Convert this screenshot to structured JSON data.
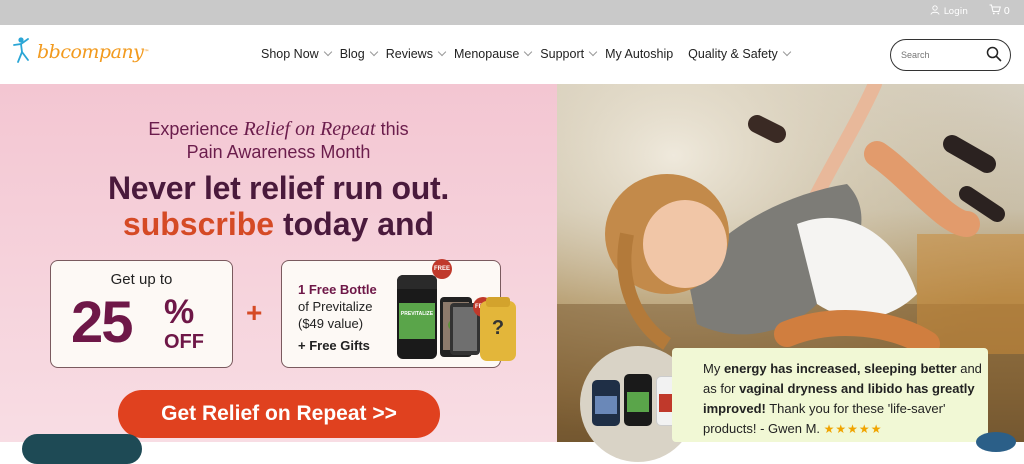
{
  "topbar": {
    "login_label": "Login",
    "cart_count": "0"
  },
  "header": {
    "logo_text": "bbcompany",
    "logo_tm": "™",
    "nav": [
      {
        "label": "Shop Now",
        "has_dropdown": true
      },
      {
        "label": "Blog",
        "has_dropdown": true
      },
      {
        "label": "Reviews",
        "has_dropdown": true
      },
      {
        "label": "Menopause",
        "has_dropdown": true
      },
      {
        "label": "Support",
        "has_dropdown": true
      },
      {
        "label": "My Autoship",
        "has_dropdown": false
      },
      {
        "label": "Quality & Safety",
        "has_dropdown": true
      }
    ],
    "search_placeholder": "Search"
  },
  "hero": {
    "line1_pre": "Experience ",
    "line1_em": "Relief on Repeat",
    "line1_post": " this",
    "line2": "Pain Awareness Month",
    "line3": "Never let relief run out.",
    "line4_accent": "subscribe",
    "line4_rest": " today and",
    "card1": {
      "upto": "Get up to",
      "big": "25",
      "pct": "%",
      "off": "OFF"
    },
    "plus": "+",
    "card2": {
      "line1": "1 Free Bottle",
      "line2": "of Previtalize",
      "line3": "($49 value)",
      "line4": "+ Free Gifts",
      "free_badge": "FREE",
      "product_label": "PREVITALIZE",
      "mystery": "?"
    },
    "cta_label": "Get Relief on Repeat >>"
  },
  "testimonial": {
    "p1": "My ",
    "b1": "energy has increased, sleeping better",
    "p2": " and as for ",
    "b2": "vaginal dryness and libido has greatly improved!",
    "p3": " Thank you for these 'life-saver' products! - Gwen M. ",
    "stars": "★★★★★"
  },
  "colors": {
    "brand": "#f29a1e",
    "plum": "#6e1747",
    "accent": "#d54a25",
    "cta": "#e0411f",
    "testimonial_bg": "#f1f8d5"
  }
}
